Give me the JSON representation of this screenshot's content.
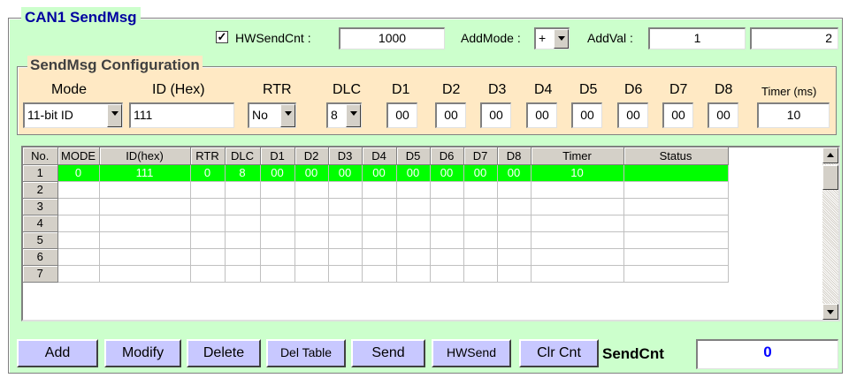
{
  "title": "CAN1 SendMsg",
  "top": {
    "hw_checked_mark": "✓",
    "hw_label": "HWSendCnt :",
    "hw_value": "1000",
    "addmode_label": "AddMode :",
    "addmode_value": "+",
    "addval_label": "AddVal :",
    "addval_value1": "1",
    "addval_value2": "2"
  },
  "config": {
    "title": "SendMsg Configuration",
    "labels": {
      "mode": "Mode",
      "id": "ID (Hex)",
      "rtr": "RTR",
      "dlc": "DLC",
      "d1": "D1",
      "d2": "D2",
      "d3": "D3",
      "d4": "D4",
      "d5": "D5",
      "d6": "D6",
      "d7": "D7",
      "d8": "D8",
      "timer": "Timer (ms)"
    },
    "values": {
      "mode": "11-bit ID",
      "id": "111",
      "rtr": "No",
      "dlc": "8",
      "d1": "00",
      "d2": "00",
      "d3": "00",
      "d4": "00",
      "d5": "00",
      "d6": "00",
      "d7": "00",
      "d8": "00",
      "timer": "10"
    }
  },
  "table": {
    "headers": [
      "No.",
      "MODE",
      "ID(hex)",
      "RTR",
      "DLC",
      "D1",
      "D2",
      "D3",
      "D4",
      "D5",
      "D6",
      "D7",
      "D8",
      "Timer",
      "Status"
    ],
    "rows": [
      {
        "no": "1",
        "cells": [
          "0",
          "111",
          "0",
          "8",
          "00",
          "00",
          "00",
          "00",
          "00",
          "00",
          "00",
          "00",
          "10",
          ""
        ],
        "selected": true
      },
      {
        "no": "2",
        "cells": [
          "",
          "",
          "",
          "",
          "",
          "",
          "",
          "",
          "",
          "",
          "",
          "",
          "",
          ""
        ]
      },
      {
        "no": "3",
        "cells": [
          "",
          "",
          "",
          "",
          "",
          "",
          "",
          "",
          "",
          "",
          "",
          "",
          "",
          ""
        ]
      },
      {
        "no": "4",
        "cells": [
          "",
          "",
          "",
          "",
          "",
          "",
          "",
          "",
          "",
          "",
          "",
          "",
          "",
          ""
        ]
      },
      {
        "no": "5",
        "cells": [
          "",
          "",
          "",
          "",
          "",
          "",
          "",
          "",
          "",
          "",
          "",
          "",
          "",
          ""
        ]
      },
      {
        "no": "6",
        "cells": [
          "",
          "",
          "",
          "",
          "",
          "",
          "",
          "",
          "",
          "",
          "",
          "",
          "",
          ""
        ]
      },
      {
        "no": "7",
        "cells": [
          "",
          "",
          "",
          "",
          "",
          "",
          "",
          "",
          "",
          "",
          "",
          "",
          "",
          ""
        ]
      }
    ]
  },
  "buttons": {
    "add": "Add",
    "modify": "Modify",
    "delete": "Delete",
    "del_table": "Del Table",
    "send": "Send",
    "hwsend": "HWSend",
    "clr_cnt": "Clr Cnt"
  },
  "sendcnt": {
    "label": "SendCnt",
    "value": "0"
  },
  "colors": {
    "panel_bg": "#ccffcc",
    "config_bg": "#ffe9c4",
    "title_color": "#0000a0",
    "selected_row": "#00ff00",
    "button_bg": "#c8c8ff",
    "sendcnt_value": "#0000ff"
  }
}
